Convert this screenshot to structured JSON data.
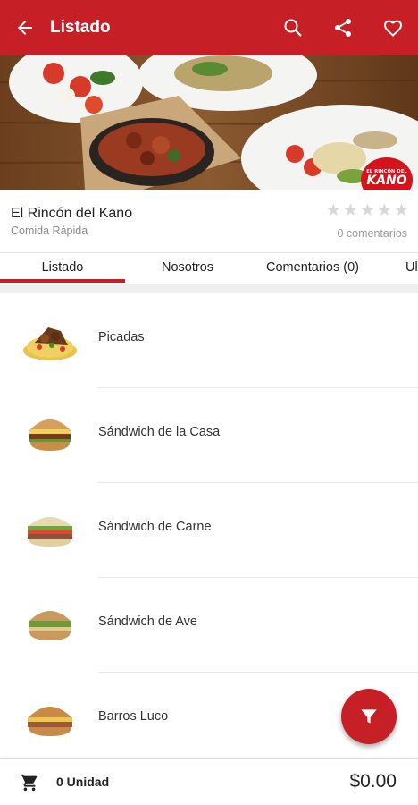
{
  "appbar": {
    "title": "Listado",
    "back_icon": "arrow-back-icon",
    "actions": [
      "search-icon",
      "share-icon",
      "favorite-outline-icon"
    ],
    "color": "#c62026"
  },
  "restaurant": {
    "name": "El Rincón del Kano",
    "category": "Comida Rápida",
    "rating": 0,
    "max_rating": 5,
    "comments": "0 comentarios",
    "logo_small_text": "EL RINCÓN DEL",
    "logo_big_text": "KANO"
  },
  "tabs": [
    {
      "label": "Listado",
      "active": true
    },
    {
      "label": "Nosotros",
      "active": false
    },
    {
      "label": "Comentarios (0)",
      "active": false
    },
    {
      "label": "Ul",
      "active": false
    }
  ],
  "items": [
    {
      "label": "Picadas",
      "icon": "picadas-dish-image"
    },
    {
      "label": "Sándwich de la Casa",
      "icon": "house-sandwich-image"
    },
    {
      "label": "Sándwich de Carne",
      "icon": "beef-sandwich-image"
    },
    {
      "label": "Sándwich de Ave",
      "icon": "chicken-sandwich-image"
    },
    {
      "label": "Barros Luco",
      "icon": "barros-luco-sandwich-image"
    }
  ],
  "fab": {
    "icon": "filter-icon"
  },
  "cart": {
    "icon": "shopping-cart-icon",
    "units": "0 Unidad",
    "total": "$0.00"
  }
}
